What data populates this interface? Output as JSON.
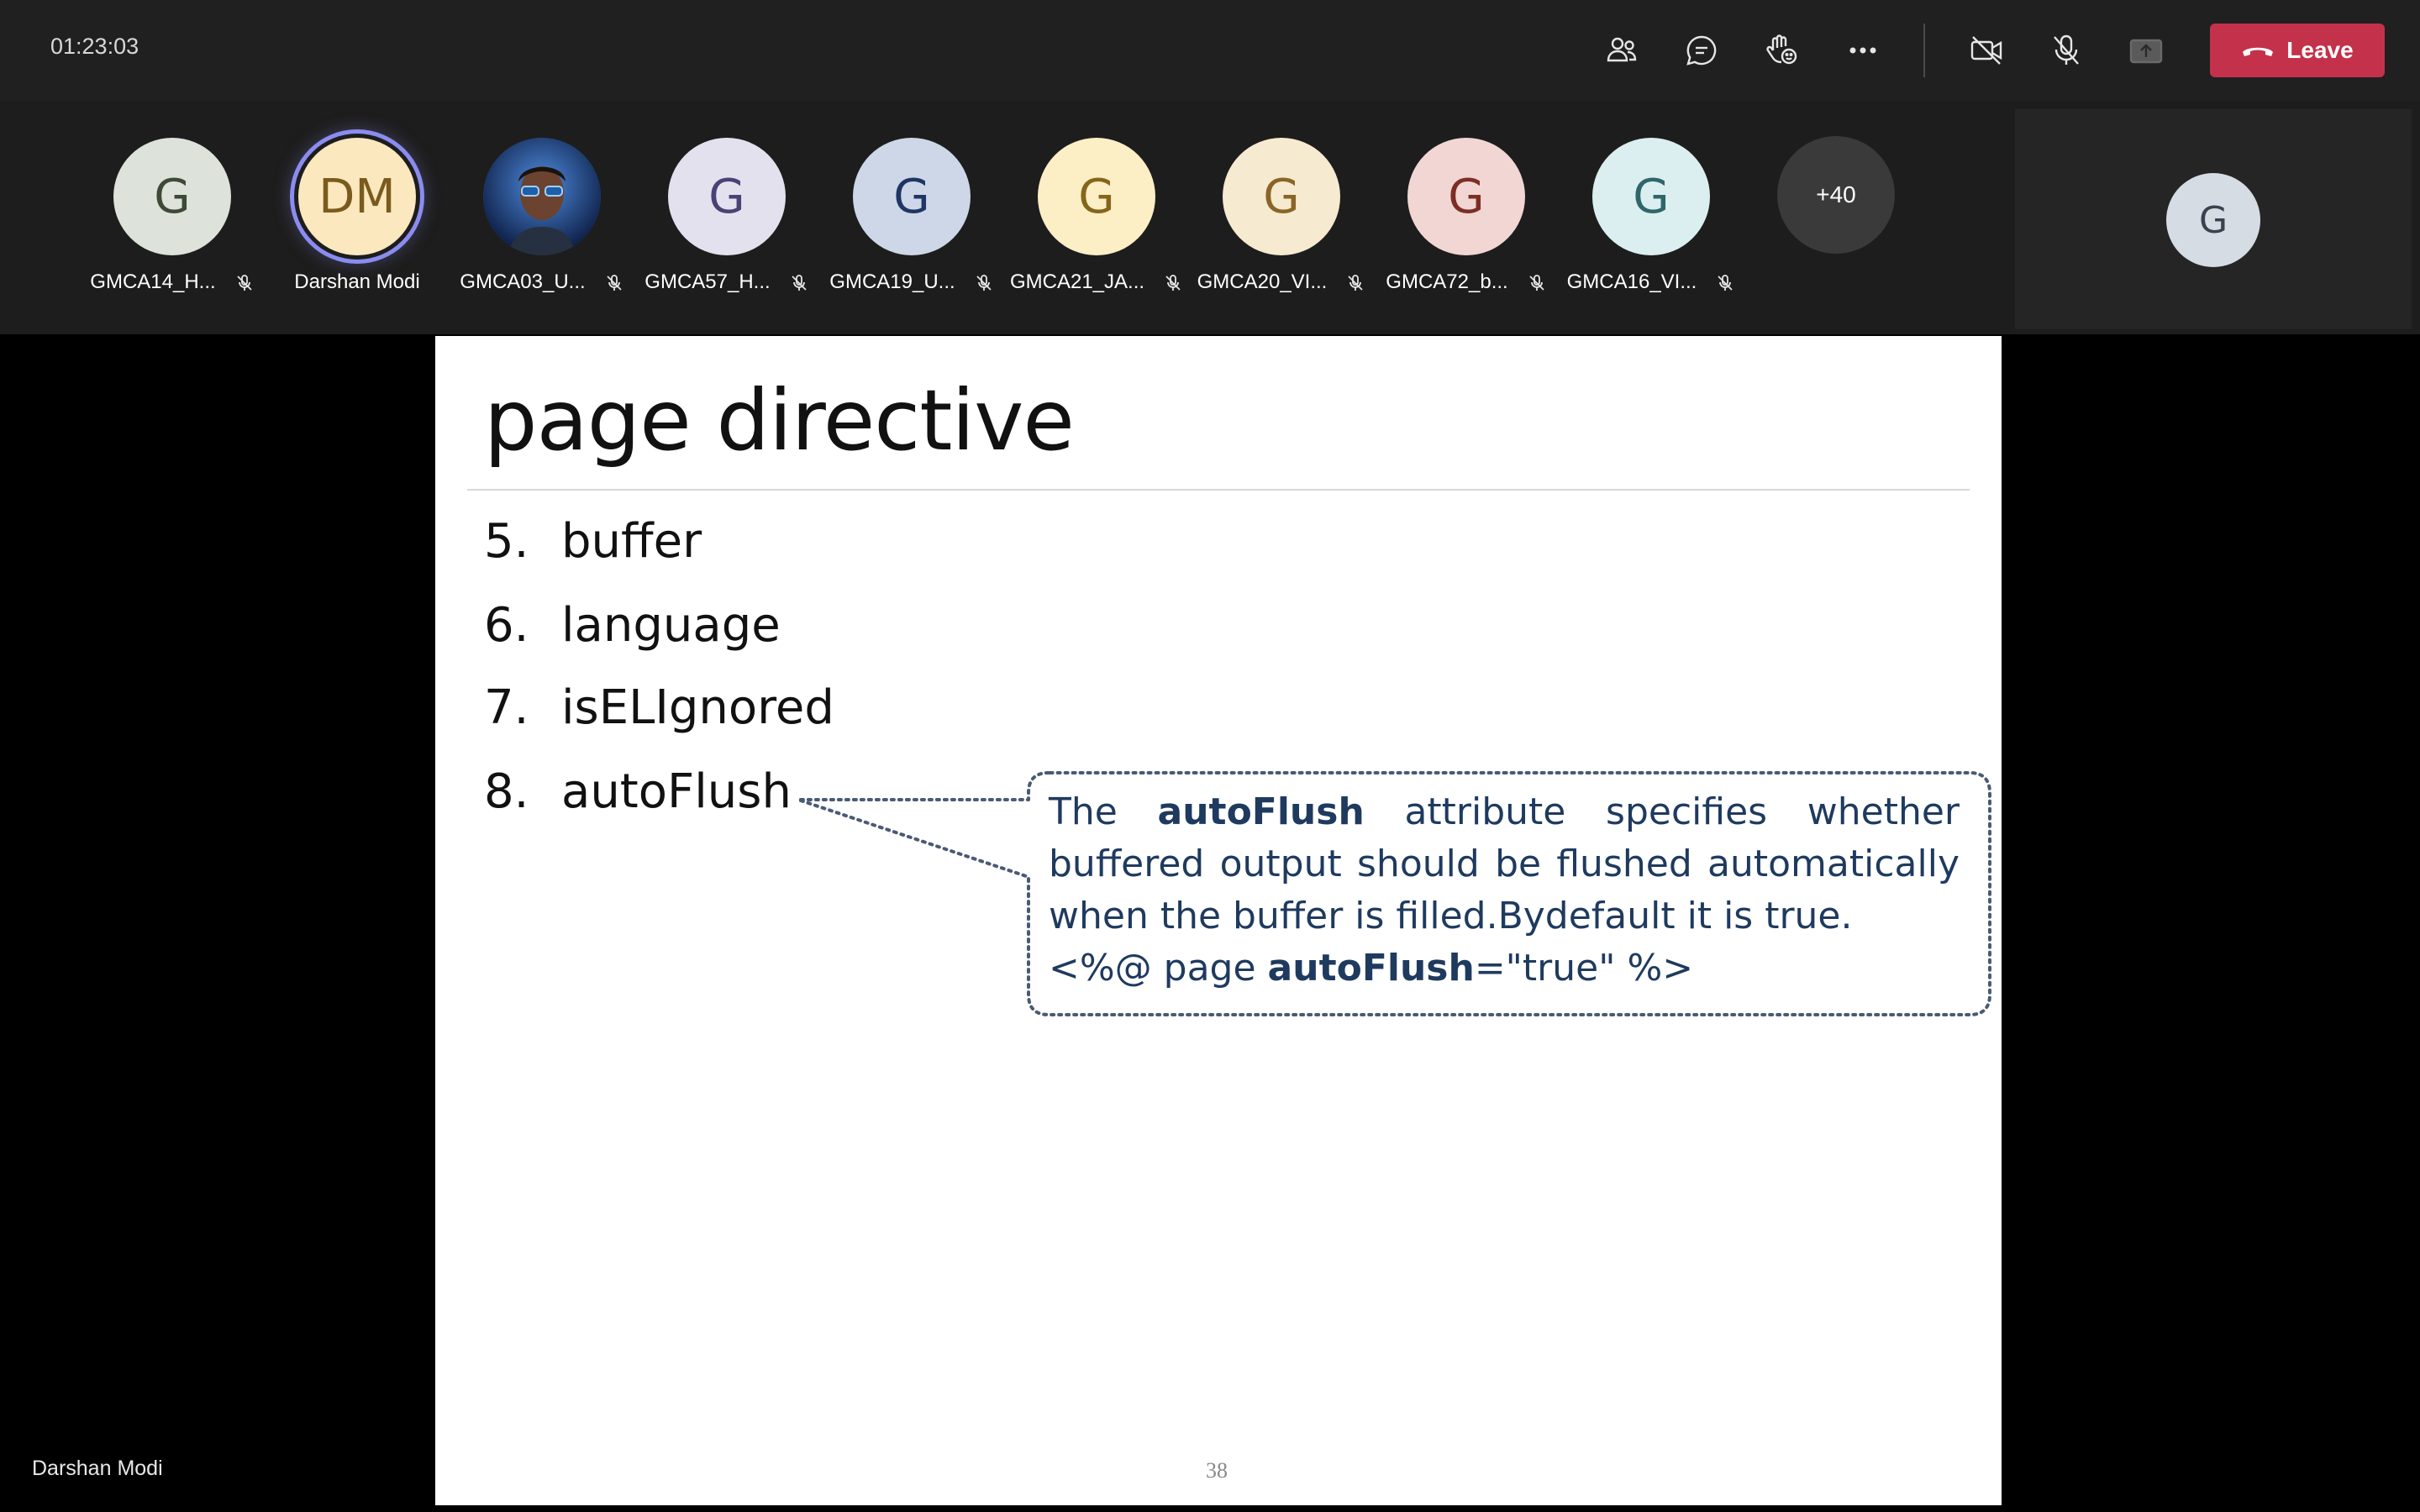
{
  "header": {
    "timer": "01:23:03",
    "leave_label": "Leave"
  },
  "controls": [
    {
      "name": "participants-icon"
    },
    {
      "name": "chat-icon"
    },
    {
      "name": "reactions-icon"
    },
    {
      "name": "more-actions-icon"
    },
    {
      "name": "camera-off-icon"
    },
    {
      "name": "mic-off-icon"
    },
    {
      "name": "share-screen-icon"
    }
  ],
  "participants": [
    {
      "initials": "G",
      "name": "GMCA14_H...",
      "bg": "#dde3da",
      "fg": "#3e4a38",
      "muted": true
    },
    {
      "initials": "DM",
      "name": "Darshan Modi",
      "bg": "#fbe8bf",
      "fg": "#7a5b1d",
      "muted": false,
      "speaking": true
    },
    {
      "initials": "",
      "name": "GMCA03_U...",
      "bg": "#2a4d8f",
      "fg": "#ffffff",
      "muted": true,
      "photo": true
    },
    {
      "initials": "G",
      "name": "GMCA57_H...",
      "bg": "#e4e1ef",
      "fg": "#4a4275",
      "muted": true
    },
    {
      "initials": "G",
      "name": "GMCA19_U...",
      "bg": "#cdd7e8",
      "fg": "#1f3564",
      "muted": true
    },
    {
      "initials": "G",
      "name": "GMCA21_JA...",
      "bg": "#fcefc5",
      "fg": "#86651b",
      "muted": true
    },
    {
      "initials": "G",
      "name": "GMCA20_VI...",
      "bg": "#f6ead0",
      "fg": "#8a6526",
      "muted": true
    },
    {
      "initials": "G",
      "name": "GMCA72_b...",
      "bg": "#f1d6d3",
      "fg": "#7c2e25",
      "muted": true
    },
    {
      "initials": "G",
      "name": "GMCA16_VI...",
      "bg": "#dbeff0",
      "fg": "#2f6669",
      "muted": true
    }
  ],
  "more_participants": "+40",
  "self_view": {
    "initials": "G"
  },
  "slide": {
    "title": "page directive",
    "items": [
      {
        "num": "5.",
        "text": "buffer"
      },
      {
        "num": "6.",
        "text": "language"
      },
      {
        "num": "7.",
        "text": "isELIgnored"
      },
      {
        "num": "8.",
        "text": "autoFlush"
      }
    ],
    "callout": {
      "line1_pre": "The ",
      "line1_bold": "autoFlush",
      "line1_post": " attribute specifies whether buffered output should be flushed automatically when the buffer is filled.Bydefault it is true.",
      "code_pre": "<%@ page ",
      "code_bold": "autoFlush",
      "code_post": "=\"true\" %>"
    },
    "page_number": "38"
  },
  "stage_label": "Darshan Modi",
  "colors": {
    "leave": "#c4314b",
    "speaking_ring": "#8b8cf0",
    "callout_text": "#1f3a5f"
  }
}
